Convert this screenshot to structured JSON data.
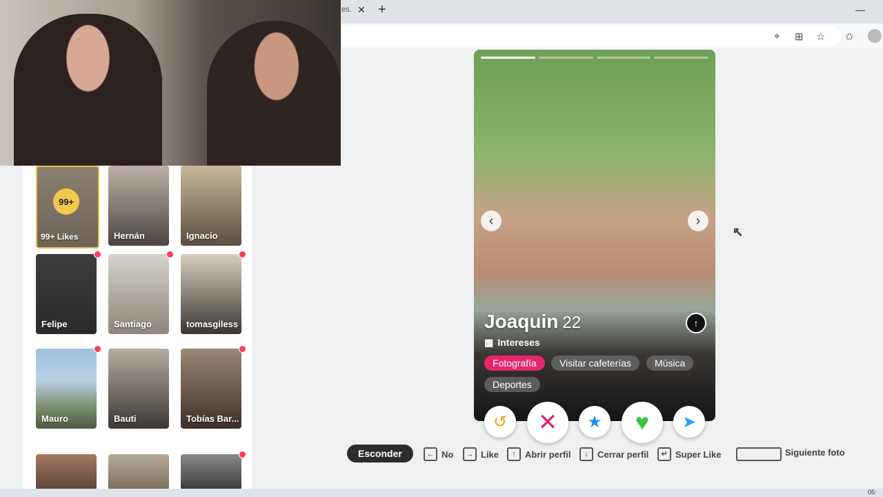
{
  "browser": {
    "tab_title": "es.",
    "close_glyph": "✕",
    "new_tab_glyph": "+",
    "minimize_glyph": "—",
    "toolbar_icons": [
      "location-icon",
      "apps-icon",
      "star-icon",
      "favorites-icon",
      "profile-avatar"
    ]
  },
  "left_panel": {
    "likes_card": {
      "badge": "99+",
      "label": "99+ Likes"
    },
    "cards": [
      {
        "name": "Hernán",
        "dot": false
      },
      {
        "name": "Ignacio",
        "dot": false
      },
      {
        "name": "Felipe",
        "dot": true
      },
      {
        "name": "Santiago",
        "dot": true
      },
      {
        "name": "tomasgiless",
        "dot": true
      },
      {
        "name": "Mauro",
        "dot": true
      },
      {
        "name": "Bauti",
        "dot": false
      },
      {
        "name": "Tobías Bar...",
        "dot": true
      }
    ]
  },
  "profile": {
    "name": "Joaquin",
    "age": "22",
    "interests_label": "Intereses",
    "interests": [
      {
        "label": "Fotografía",
        "active": true
      },
      {
        "label": "Visitar cafeterías",
        "active": false
      },
      {
        "label": "Música",
        "active": false
      },
      {
        "label": "Deportes",
        "active": false
      }
    ],
    "photo_count": 4,
    "current_photo": 1,
    "prev_glyph": "‹",
    "next_glyph": "›",
    "up_glyph": "↑"
  },
  "actions": [
    {
      "name": "rewind-button",
      "glyph": "↺",
      "color": "#e6a700"
    },
    {
      "name": "nope-button",
      "glyph": "✕",
      "color": "#e5266f"
    },
    {
      "name": "super-like-button",
      "glyph": "★",
      "color": "#1f8ef2"
    },
    {
      "name": "like-button",
      "glyph": "♥",
      "color": "#3cc43c"
    },
    {
      "name": "boost-button",
      "glyph": "➤",
      "color": "#2aa3f0"
    }
  ],
  "shortcuts": {
    "hide": "Esconder",
    "no": "No",
    "like": "Like",
    "open_profile": "Abrir perfil",
    "close_profile": "Cerrar perfil",
    "super_like": "Super Like",
    "next_photo": "Siguiente foto",
    "keys": {
      "left": "←",
      "right": "→",
      "up": "↑",
      "down": "↓",
      "enter": "↵"
    }
  },
  "taskbar": {
    "clock": "05:"
  }
}
